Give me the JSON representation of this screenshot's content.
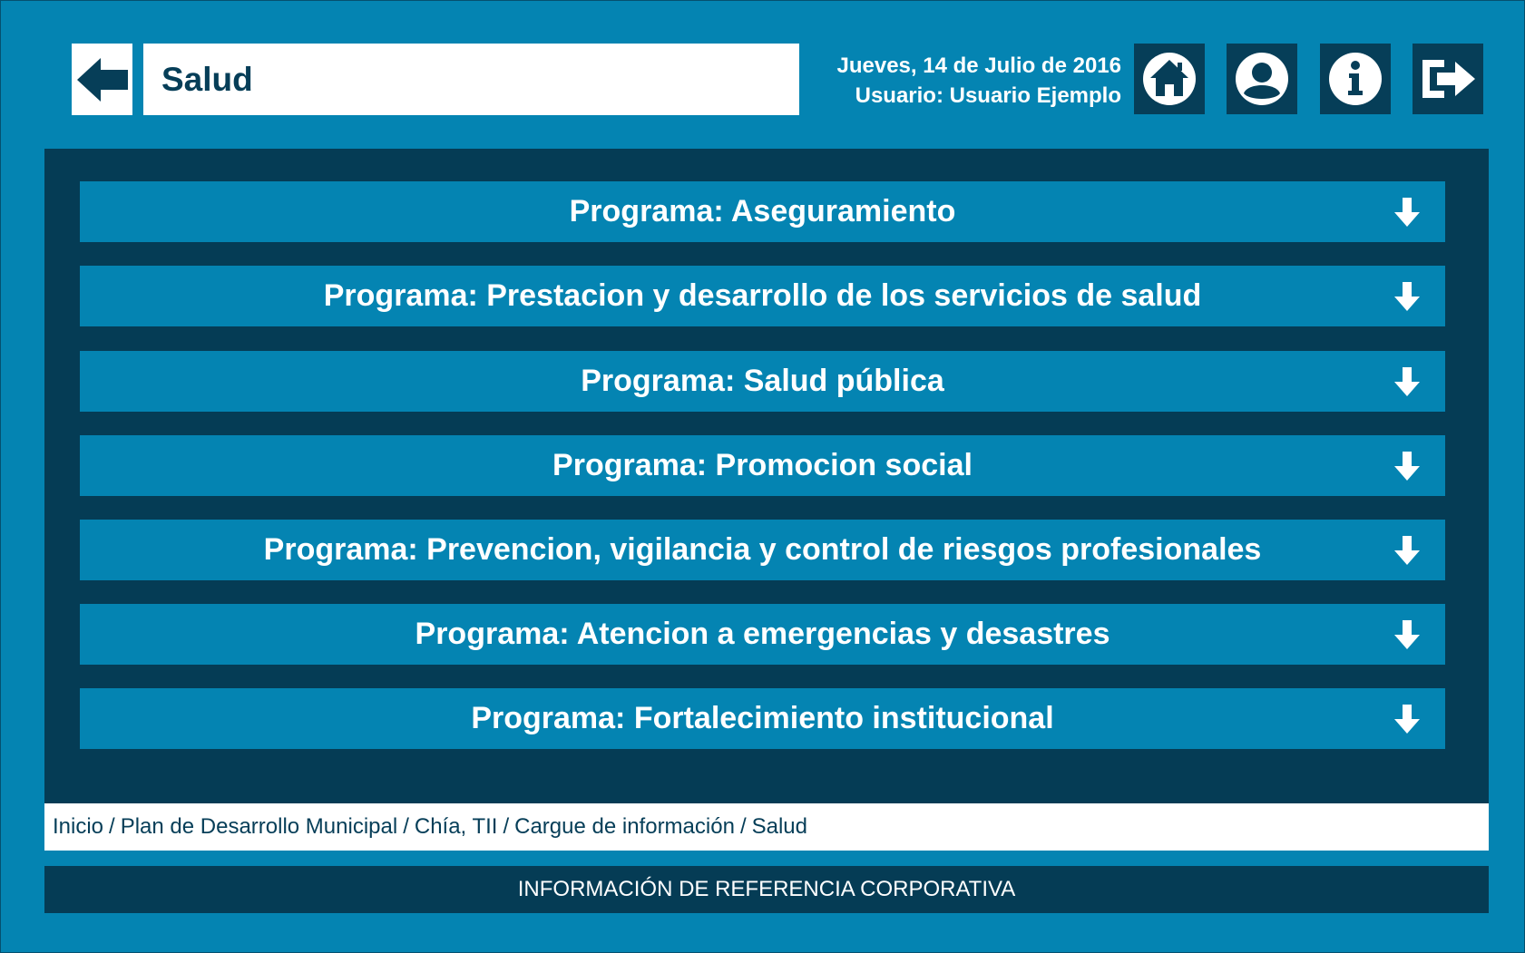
{
  "header": {
    "title": "Salud",
    "date": "Jueves, 14 de Julio de 2016",
    "user": "Usuario: Usuario Ejemplo",
    "icons": [
      "arrow-left-icon",
      "home-icon",
      "user-icon",
      "info-icon",
      "logout-icon"
    ]
  },
  "programs": [
    "Programa: Aseguramiento",
    "Programa: Prestacion y desarrollo de los servicios de salud",
    "Programa: Salud pública",
    "Programa: Promocion social",
    "Programa: Prevencion, vigilancia y control de riesgos profesionales",
    "Programa: Atencion a emergencias y desastres",
    "Programa: Fortalecimiento institucional"
  ],
  "breadcrumb": {
    "items": [
      "Inicio",
      "Plan de Desarrollo Municipal",
      "Chía, TII",
      "Cargue de información",
      "Salud"
    ],
    "separator": "/"
  },
  "footer": {
    "text": "INFORMACIÓN DE REFERENCIA CORPORATIVA"
  },
  "colors": {
    "background": "#0484b2",
    "panel": "#053c55",
    "text_dark": "#063e58",
    "white": "#ffffff"
  }
}
